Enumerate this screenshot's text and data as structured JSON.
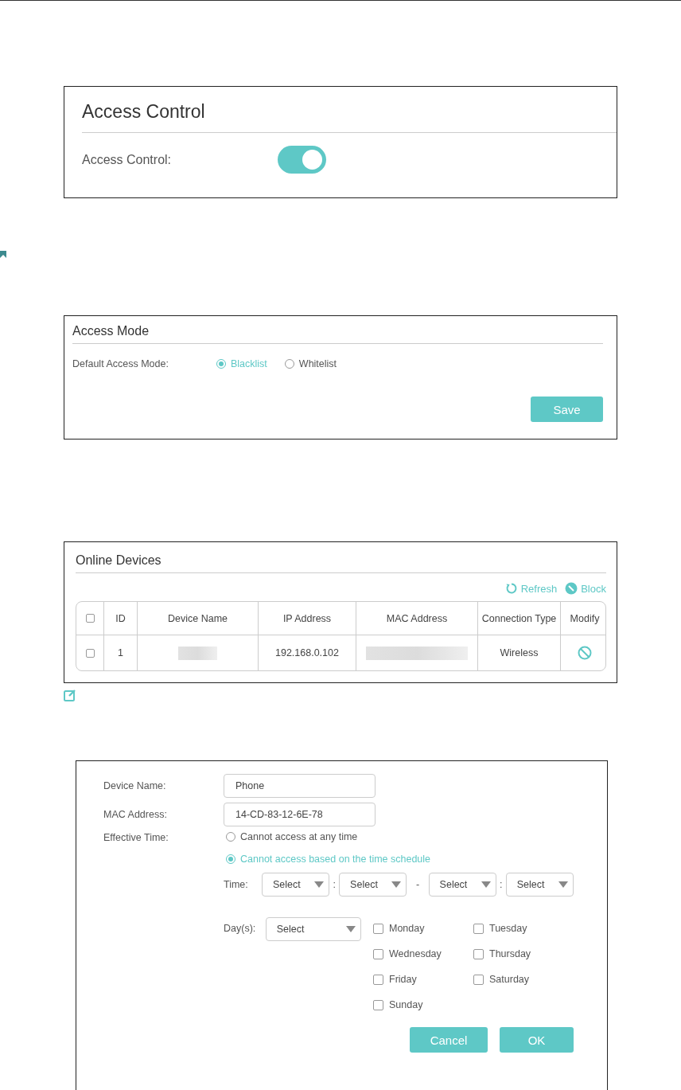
{
  "access_control": {
    "title": "Access Control",
    "label": "Access Control:",
    "on": true
  },
  "access_mode": {
    "title": "Access Mode",
    "label": "Default Access Mode:",
    "options": [
      {
        "label": "Blacklist",
        "selected": true
      },
      {
        "label": "Whitelist",
        "selected": false
      }
    ],
    "save": "Save"
  },
  "online_devices": {
    "title": "Online Devices",
    "actions": [
      {
        "kind": "refresh",
        "label": "Refresh"
      },
      {
        "kind": "block",
        "label": "Block"
      }
    ],
    "columns": [
      "ID",
      "Device Name",
      "IP Address",
      "MAC Address",
      "Connection Type",
      "Modify"
    ],
    "header_checked": false,
    "rows": [
      {
        "checked": false,
        "id": "1",
        "ip": "192.168.0.102",
        "connection": "Wireless"
      }
    ]
  },
  "edit_form": {
    "fields": [
      {
        "label": "Device Name:",
        "value": "Phone"
      },
      {
        "label": "MAC Address:",
        "value": "14-CD-83-12-6E-78"
      }
    ],
    "effective_time": {
      "label": "Effective Time:",
      "options": [
        {
          "label": "Cannot access at any time",
          "selected": false
        },
        {
          "label": "Cannot access based on the time schedule",
          "selected": true
        }
      ]
    },
    "time": {
      "label": "Time:",
      "selects": [
        "Select",
        "Select",
        "Select",
        "Select"
      ],
      "separators": [
        ":",
        "-",
        ":"
      ]
    },
    "days": {
      "label": "Day(s):",
      "select": "Select",
      "items": [
        {
          "label": "Monday",
          "checked": false
        },
        {
          "label": "Tuesday",
          "checked": false
        },
        {
          "label": "Wednesday",
          "checked": false
        },
        {
          "label": "Thursday",
          "checked": false
        },
        {
          "label": "Friday",
          "checked": false
        },
        {
          "label": "Saturday",
          "checked": false
        },
        {
          "label": "Sunday",
          "checked": false
        }
      ]
    },
    "buttons": [
      "Cancel",
      "OK"
    ]
  }
}
